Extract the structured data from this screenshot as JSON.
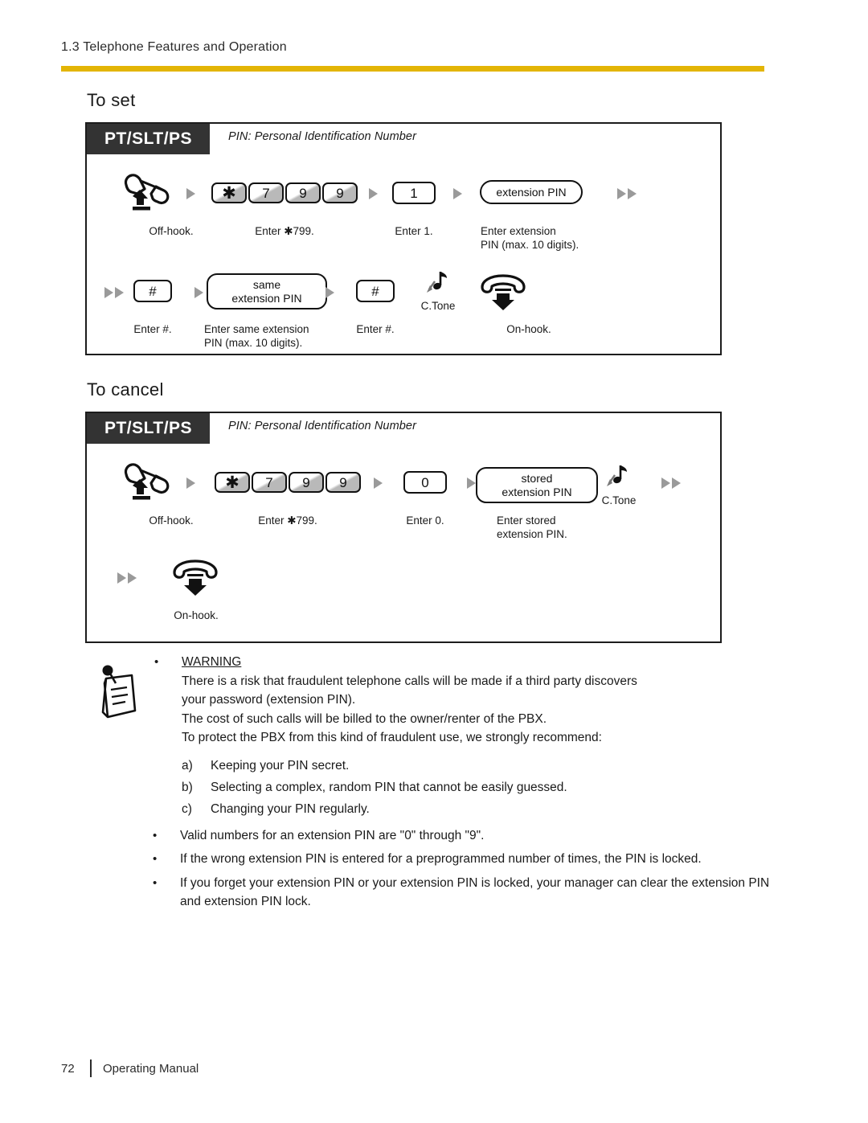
{
  "header": {
    "breadcrumb": "1.3 Telephone Features and Operation",
    "rule_color": "#e3b505"
  },
  "sections": [
    {
      "id": "to-set",
      "title": "To set"
    },
    {
      "id": "to-cancel",
      "title": "To cancel"
    }
  ],
  "diagram_set": {
    "device_tab": "PT/SLT/PS",
    "pin_note": "PIN: Personal Identification Number",
    "row1": {
      "offhook_caption": "Off-hook.",
      "keys": [
        "✱",
        "7",
        "9",
        "9"
      ],
      "keys_caption": "Enter ✱799.",
      "one_key": "1",
      "one_caption": "Enter 1.",
      "pin_pill": "extension PIN",
      "pin_caption": "Enter extension\nPIN (max. 10 digits)."
    },
    "row2": {
      "hash_key": "#",
      "hash_caption": "Enter #.",
      "same_pin_pill_line1": "same",
      "same_pin_pill_line2": "extension PIN",
      "same_pin_caption": "Enter same extension\nPIN (max. 10 digits).",
      "hash_key_2": "#",
      "hash_caption_2": "Enter #.",
      "ctone_label": "C.Tone",
      "onhook_caption": "On-hook."
    }
  },
  "diagram_cancel": {
    "device_tab": "PT/SLT/PS",
    "pin_note": "PIN: Personal Identification Number",
    "row1": {
      "offhook_caption": "Off-hook.",
      "keys": [
        "✱",
        "7",
        "9",
        "9"
      ],
      "keys_caption": "Enter ✱799.",
      "zero_key": "0",
      "zero_caption": "Enter 0.",
      "stored_pill_line1": "stored",
      "stored_pill_line2": "extension PIN",
      "stored_caption": "Enter stored\nextension PIN.",
      "ctone_label": "C.Tone"
    },
    "row2": {
      "onhook_caption": "On-hook."
    }
  },
  "warning": {
    "bullet": "•",
    "title": "WARNING",
    "paragraphs": [
      "There is a risk that fraudulent telephone calls will be made if a third party discovers",
      "your password (extension PIN).",
      "The cost of such calls will be billed to the owner/renter of the PBX.",
      "To protect the PBX from this kind of fraudulent use, we strongly recommend:"
    ],
    "items": [
      {
        "label": "a)",
        "text": "Keeping your PIN secret."
      },
      {
        "label": "b)",
        "text": "Selecting a complex, random PIN that cannot be easily guessed."
      },
      {
        "label": "c)",
        "text": "Changing your PIN regularly."
      }
    ],
    "notes": [
      "Valid numbers for an extension PIN are \"0\" through \"9\".",
      "If the wrong extension PIN is entered for a preprogrammed number of times, the PIN is locked.",
      "If you forget your extension PIN or your extension PIN is locked, your manager can clear the extension PIN and extension PIN lock."
    ]
  },
  "footer": {
    "page_number": "72",
    "doc_title": "Operating Manual"
  }
}
